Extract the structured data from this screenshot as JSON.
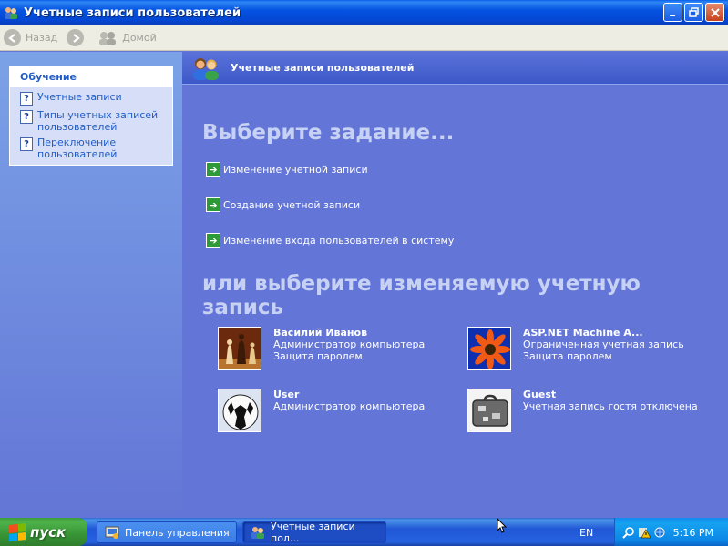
{
  "window": {
    "title": "Учетные записи пользователей"
  },
  "toolbar": {
    "back_label": "Назад",
    "home_label": "Домой"
  },
  "sidebar": {
    "heading": "Обучение",
    "items": [
      {
        "label": "Учетные записи"
      },
      {
        "label": "Типы учетных записей пользователей"
      },
      {
        "label": "Переключение пользователей"
      }
    ]
  },
  "main": {
    "header_title": "Учетные записи пользователей",
    "task_heading": "Выберите задание...",
    "tasks": [
      {
        "label": "Изменение учетной записи"
      },
      {
        "label": "Создание учетной записи"
      },
      {
        "label": "Изменение входа пользователей в систему"
      }
    ],
    "accounts_heading": "или выберите изменяемую учетную запись",
    "accounts": [
      {
        "name": "Василий Иванов",
        "line1": "Администратор компьютера",
        "line2": "Защита паролем",
        "picture": "chess"
      },
      {
        "name": "ASP.NET Machine A...",
        "line1": "Ограниченная учетная запись",
        "line2": "Защита паролем",
        "picture": "flower"
      },
      {
        "name": "User",
        "line1": "Администратор компьютера",
        "line2": "",
        "picture": "soccer-ball"
      },
      {
        "name": "Guest",
        "line1": "Учетная запись гостя отключена",
        "line2": "",
        "picture": "suitcase"
      }
    ]
  },
  "taskbar": {
    "start_label": "пуск",
    "buttons": [
      {
        "label": "Панель управления",
        "active": false
      },
      {
        "label": "Учетные записи пол...",
        "active": true
      }
    ],
    "language": "EN",
    "clock": "5:16 PM"
  },
  "colors": {
    "main_bg": "#6375D6",
    "link_blue": "#215DC6",
    "task_green": "#2D9A37",
    "heading_light": "#C6D1F4"
  }
}
